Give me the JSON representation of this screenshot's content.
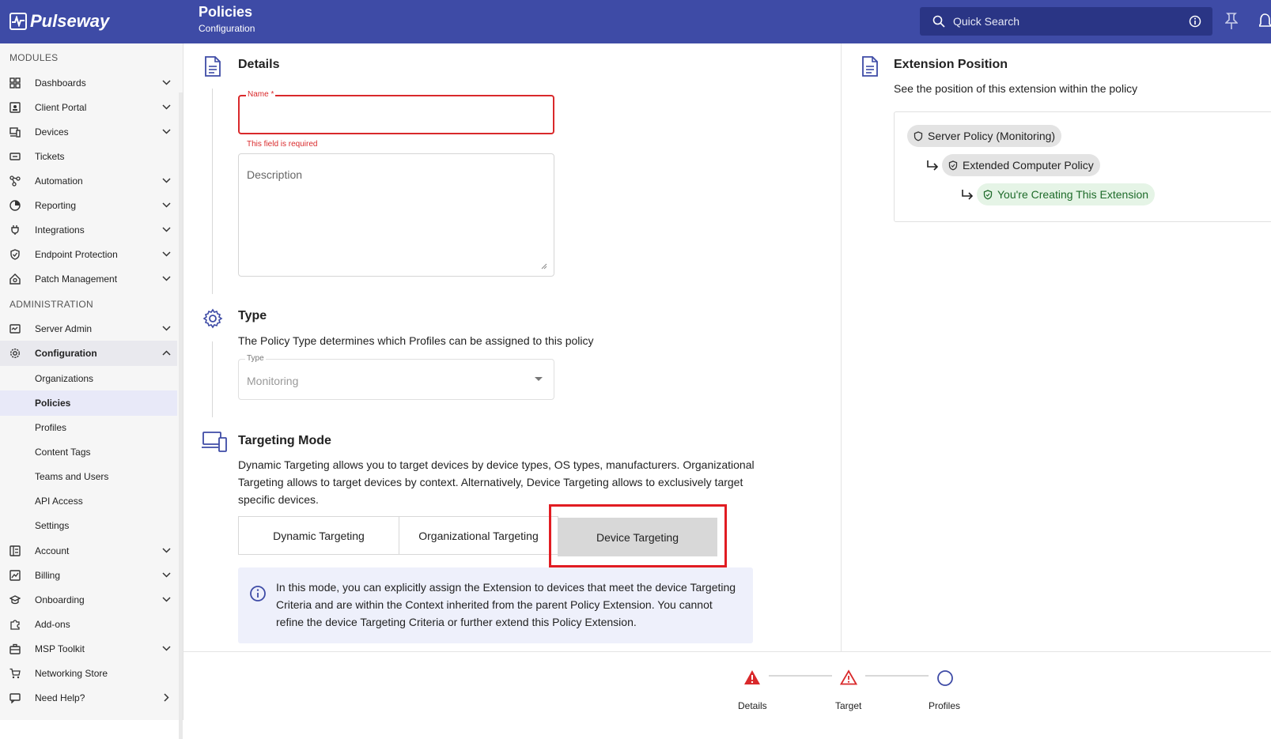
{
  "app": {
    "brand": "Pulseway",
    "title": "Policies",
    "subtitle": "Configuration"
  },
  "search": {
    "placeholder": "Quick Search"
  },
  "sidebar": {
    "sections": [
      "MODULES",
      "ADMINISTRATION"
    ],
    "modules": [
      {
        "label": "Dashboards"
      },
      {
        "label": "Client Portal"
      },
      {
        "label": "Devices"
      },
      {
        "label": "Tickets"
      },
      {
        "label": "Automation"
      },
      {
        "label": "Reporting"
      },
      {
        "label": "Integrations"
      },
      {
        "label": "Endpoint Protection"
      },
      {
        "label": "Patch Management"
      }
    ],
    "admin": [
      {
        "label": "Server Admin"
      },
      {
        "label": "Configuration"
      }
    ],
    "config_sub": [
      "Organizations",
      "Policies",
      "Profiles",
      "Content Tags",
      "Teams and Users",
      "API Access",
      "Settings"
    ],
    "rest": [
      {
        "label": "Account"
      },
      {
        "label": "Billing"
      },
      {
        "label": "Onboarding"
      },
      {
        "label": "Add-ons"
      },
      {
        "label": "MSP Toolkit"
      },
      {
        "label": "Networking Store"
      },
      {
        "label": "Need Help?"
      }
    ]
  },
  "details": {
    "title": "Details",
    "name_label": "Name *",
    "name_value": "",
    "name_error": "This field is required",
    "description_placeholder": "Description"
  },
  "type": {
    "title": "Type",
    "description": "The Policy Type determines which Profiles can be assigned to this policy",
    "label": "Type",
    "value": "Monitoring"
  },
  "targeting": {
    "title": "Targeting Mode",
    "description": "Dynamic Targeting allows you to target devices by device types, OS types, manufacturers. Organizational Targeting allows to target devices by context. Alternatively, Device Targeting allows to exclusively target specific devices.",
    "options": [
      "Dynamic Targeting",
      "Organizational Targeting",
      "Device Targeting"
    ],
    "selected": "Device Targeting",
    "info": "In this mode, you can explicitly assign the Extension to devices that meet the device Targeting Criteria and are within the Context inherited from the parent Policy Extension. You cannot refine the device Targeting Criteria or further extend this Policy Extension."
  },
  "extension": {
    "title": "Extension Position",
    "description": "See the position of this extension within the policy",
    "chain": [
      "Server Policy (Monitoring)",
      "Extended Computer Policy",
      "You're Creating This Extension"
    ]
  },
  "stepper": {
    "steps": [
      "Details",
      "Target",
      "Profiles"
    ]
  },
  "colors": {
    "topbar": "#3e4ba6",
    "error": "#d9292b",
    "highlight": "#e11c22",
    "success_chip": "#e5f4e6"
  }
}
